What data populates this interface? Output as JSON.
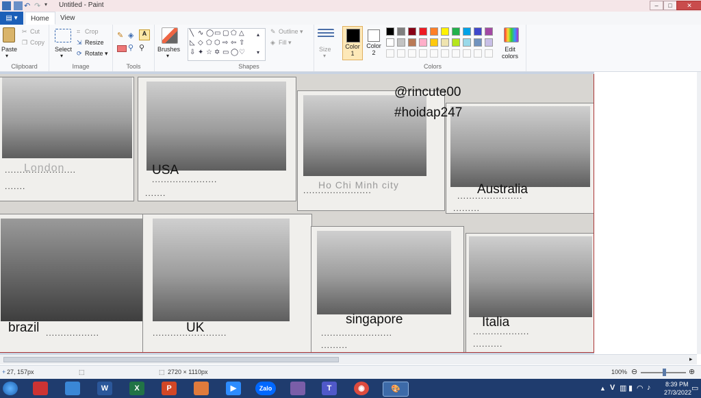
{
  "app": {
    "window_title": "Untitled - Paint",
    "window_buttons": {
      "minimize": "–",
      "maximize": "□",
      "close": "✕"
    }
  },
  "tabs": {
    "file": "▤ ▾",
    "home": "Home",
    "view": "View"
  },
  "ribbon": {
    "clipboard": {
      "group": "Clipboard",
      "paste": "Paste",
      "cut": "Cut",
      "copy": "Copy"
    },
    "image": {
      "group": "Image",
      "select": "Select",
      "crop": "Crop",
      "resize": "Resize",
      "rotate": "Rotate ▾"
    },
    "tools": {
      "group": "Tools"
    },
    "brushes": {
      "label": "Brushes"
    },
    "shapes": {
      "group": "Shapes",
      "outline": "Outline ▾",
      "fill": "Fill ▾"
    },
    "size": {
      "label": "Size"
    },
    "colors": {
      "group": "Colors",
      "color1": "Color 1",
      "color2": "Color 2",
      "edit_colors": "Edit colors",
      "palette_row1": [
        "#000000",
        "#7f7f7f",
        "#880015",
        "#ed1c24",
        "#ff7f27",
        "#fff200",
        "#22b14c",
        "#00a2e8",
        "#3f48cc",
        "#a349a4"
      ],
      "palette_row2": [
        "#ffffff",
        "#c3c3c3",
        "#b97a57",
        "#ffaec9",
        "#ffc90e",
        "#efe4b0",
        "#b5e61d",
        "#99d9ea",
        "#7092be",
        "#c8bfe7"
      ]
    }
  },
  "canvas": {
    "overlay": {
      "handle": "@rincute00",
      "hashtag": "#hoidap247"
    },
    "cells": [
      {
        "id": "london",
        "printed": "London",
        "answer": ""
      },
      {
        "id": "usa",
        "printed": "",
        "answer": "USA"
      },
      {
        "id": "hcm",
        "printed": "Ho Chi Minh city",
        "answer": ""
      },
      {
        "id": "australia",
        "printed": "",
        "answer": "Australia"
      },
      {
        "id": "brazil",
        "printed": "",
        "answer": "brazil"
      },
      {
        "id": "uk",
        "printed": "",
        "answer": "UK"
      },
      {
        "id": "singapore",
        "printed": "",
        "answer": "singapore"
      },
      {
        "id": "italia",
        "printed": "",
        "answer": "Italia"
      }
    ],
    "dots": "........................"
  },
  "status": {
    "cursor": "27, 157px",
    "image_size": "2720 × 1110px",
    "zoom": "100%"
  },
  "taskbar": {
    "apps": [
      "Word",
      "Excel",
      "PowerPoint",
      "Zoom",
      "Zalo",
      "Teams",
      "Chrome",
      "Paint"
    ],
    "app_icons": {
      "word": "W",
      "excel": "X",
      "powerpoint": "P",
      "zoom": "▶",
      "zalo": "Zalo",
      "teams": "T",
      "chrome": "◉",
      "paint": "🎨"
    },
    "time": "8:39 PM",
    "date": "27/3/2022",
    "tray_v": "V"
  }
}
